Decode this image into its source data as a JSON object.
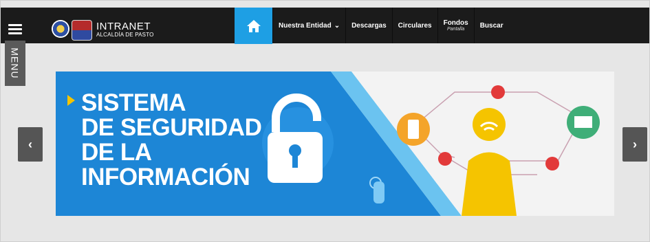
{
  "header": {
    "title": "INTRANET",
    "subtitle": "ALCALDÍA DE PASTO"
  },
  "sidebar": {
    "menu_label": "MENU"
  },
  "nav": {
    "home_icon": "home-icon",
    "items": [
      {
        "label": "Nuestra Entidad",
        "has_dropdown": true
      },
      {
        "label": "Descargas"
      },
      {
        "label": "Circulares"
      },
      {
        "label": "Fondos",
        "sub": "Pantalla"
      },
      {
        "label": "Buscar"
      }
    ]
  },
  "carousel": {
    "prev_icon": "chevron-left-icon",
    "next_icon": "chevron-right-icon",
    "slide": {
      "lines": [
        "SISTEMA",
        "DE SEGURIDAD",
        "DE LA",
        "INFORMACIÓN"
      ]
    }
  },
  "colors": {
    "topbar": "#1b1b1b",
    "accent": "#1e9fe4",
    "banner_blue": "#1d86d6",
    "yellow": "#f5c400"
  }
}
